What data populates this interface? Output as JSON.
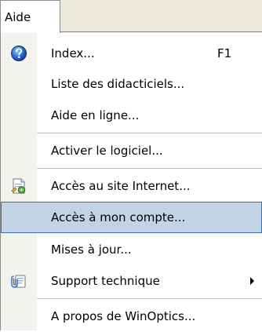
{
  "menubar": {
    "active_menu": "Aide"
  },
  "menu": {
    "items": [
      {
        "label": "Index...",
        "accelerator": "F1",
        "icon": "help-circle-icon"
      },
      {
        "label": "Liste des didacticiels..."
      },
      {
        "label": "Aide en ligne..."
      },
      {
        "label": "Activer le logiciel..."
      },
      {
        "label": "Accès au site Internet...",
        "icon": "web-page-icon"
      },
      {
        "label": "Accès à mon compte...",
        "state": "highlighted"
      },
      {
        "label": "Mises à jour..."
      },
      {
        "label": "Support technique",
        "icon": "support-icon",
        "submenu": true
      },
      {
        "label": "A propos de WinOptics..."
      }
    ]
  },
  "colors": {
    "highlight_fill": "#c3d3e6",
    "highlight_border": "#3a6ea5",
    "help_icon_blue": "#2a6fd6"
  }
}
